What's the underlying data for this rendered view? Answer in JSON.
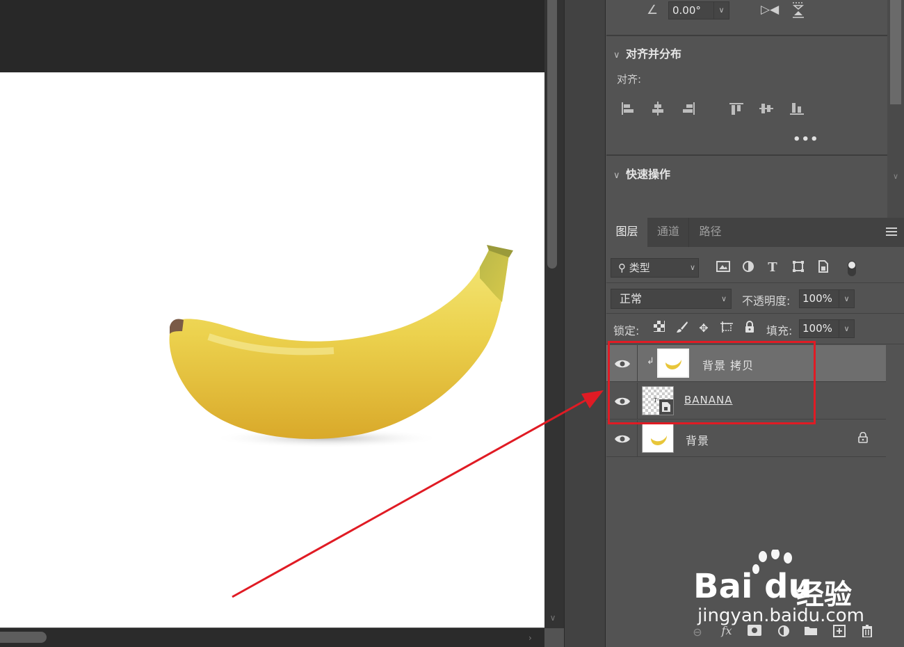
{
  "properties": {
    "angle_value": "0.00°",
    "section_align": "对齐并分布",
    "align_label": "对齐:",
    "more": "•••",
    "section_quick": "快速操作"
  },
  "layers_panel": {
    "tabs": [
      {
        "label": "图层"
      },
      {
        "label": "通道"
      },
      {
        "label": "路径"
      }
    ],
    "filter_label": "类型",
    "blend_mode": "正常",
    "opacity_label": "不透明度:",
    "opacity_value": "100%",
    "lock_label": "锁定:",
    "fill_label": "填充:",
    "fill_value": "100%",
    "layers": [
      {
        "name": "背景 拷贝",
        "selected": true
      },
      {
        "name": "BANANA"
      },
      {
        "name": "背景",
        "locked": true
      }
    ]
  },
  "annotation": {
    "color": "#e01b24"
  },
  "watermark": {
    "logo": "Bai du",
    "cn": "经验",
    "url": "jingyan.baidu.com"
  }
}
